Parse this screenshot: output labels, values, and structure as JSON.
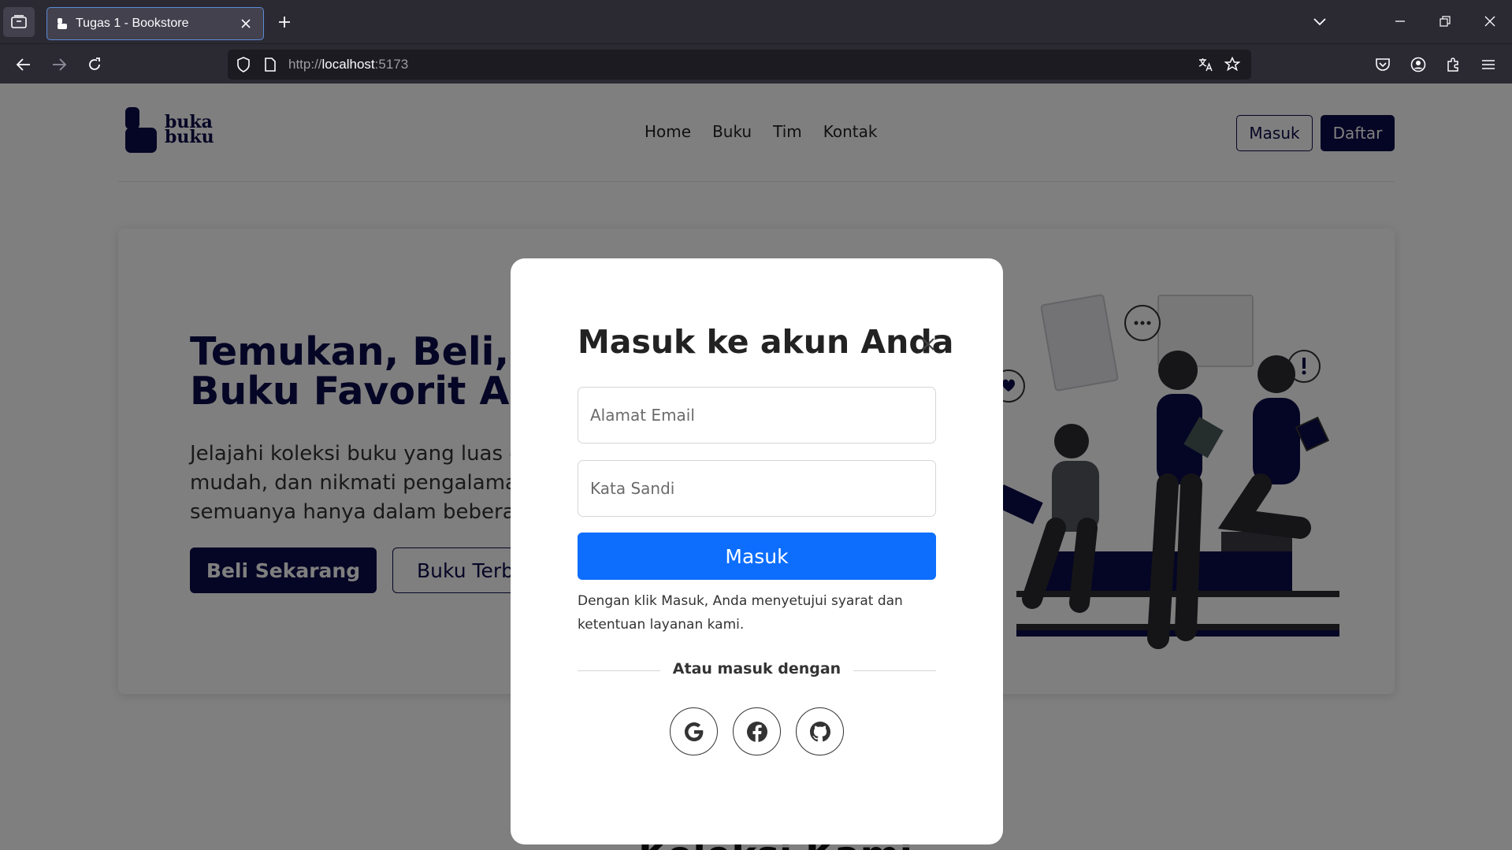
{
  "browser": {
    "tab_title": "Tugas 1 - Bookstore",
    "url_prefix": "http://",
    "url_host": "localhost",
    "url_port": ":5173"
  },
  "site": {
    "logo_line1": "buka",
    "logo_line2": "buku",
    "nav": [
      "Home",
      "Buku",
      "Tim",
      "Kontak"
    ],
    "login_label": "Masuk",
    "register_label": "Daftar"
  },
  "hero": {
    "title_line1": "Temukan, Beli, d",
    "title_line2": "Buku Favorit An",
    "desc_line1": "Jelajahi koleksi buku yang luas de",
    "desc_line2": "mudah, dan nikmati pengalaman",
    "desc_line3": "semuanya hanya dalam bebera",
    "buy_label": "Beli Sekarang",
    "latest_label": "Buku Terb"
  },
  "section": {
    "title": "Koleksi Kami"
  },
  "modal": {
    "title": "Masuk ke akun Anda",
    "email_placeholder": "Alamat Email",
    "password_placeholder": "Kata Sandi",
    "submit_label": "Masuk",
    "terms": "Dengan klik Masuk, Anda menyetujui syarat dan ketentuan layanan kami.",
    "divider_text": "Atau masuk dengan",
    "social": [
      "google-icon",
      "facebook-icon",
      "github-icon"
    ]
  },
  "colors": {
    "brand": "#0b0a4a",
    "primary": "#0d6efd",
    "overlay": "rgba(0,0,0,0.5)"
  }
}
